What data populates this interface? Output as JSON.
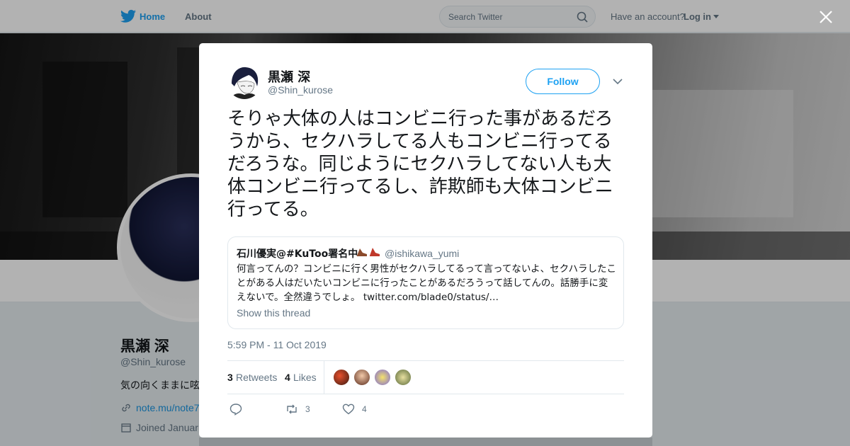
{
  "nav": {
    "home_label": "Home",
    "about_label": "About",
    "search_placeholder": "Search Twitter",
    "account_prompt": "Have an account?",
    "login_label": "Log in",
    "brand_color": "#1da1f2"
  },
  "profile": {
    "name": "黒瀬 深",
    "handle": "@Shin_kurose",
    "bio": "気の向くままに呟",
    "url": "note.mu/note7",
    "joined": "Joined Januar"
  },
  "tweet": {
    "author_name": "黒瀬 深",
    "author_handle": "@Shin_kurose",
    "follow_label": "Follow",
    "text": "そりゃ大体の人はコンビニ行った事があるだろうから、セクハラしてる人もコンビニ行ってるだろうな。同じようにセクハラしてない人も大体コンビニ行ってるし、詐欺師も大体コンビニ行ってる。",
    "timestamp": "5:59 PM - 11 Oct 2019",
    "retweets_count": "3",
    "retweets_label": "Retweets",
    "likes_count": "4",
    "likes_label": "Likes",
    "action_retweet_count": "3",
    "action_like_count": "4"
  },
  "quoted": {
    "name": "石川優実@#KuToo署名中",
    "handle": "@ishikawa_yumi",
    "text": "何言ってんの？コンビニに行く男性がセクハラしてるって言ってないよ、セクハラしたことがある人はだいたいコンビニに行ったことがあるだろうって話してんの。話勝手に変えないで。全然違うでしょ。",
    "link": "twitter.com/blade0/status/…",
    "show_thread": "Show this thread"
  },
  "icons": {
    "logo": "twitter-bird-icon",
    "search": "magnifier-icon",
    "close": "close-icon",
    "reply": "reply-icon",
    "retweet": "retweet-icon",
    "like": "heart-icon"
  }
}
